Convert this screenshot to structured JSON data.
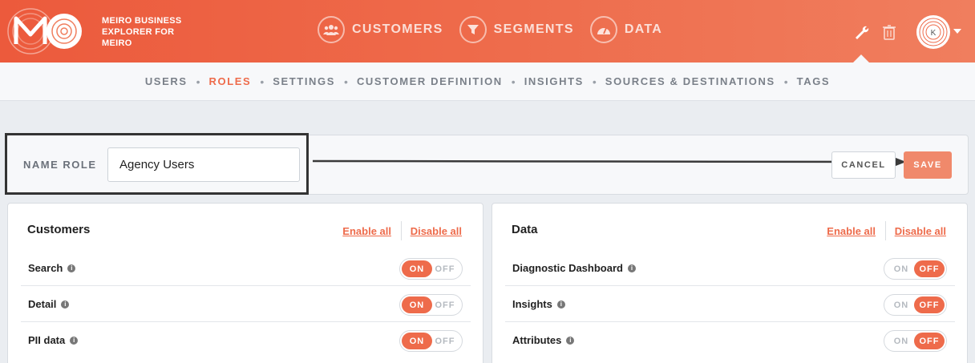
{
  "brand": {
    "logo_text": "MO",
    "line1": "MEIRO BUSINESS",
    "line2": "EXPLORER FOR",
    "line3": "MEIRO"
  },
  "nav": [
    {
      "label": "CUSTOMERS",
      "icon": "users-icon"
    },
    {
      "label": "SEGMENTS",
      "icon": "filter-icon"
    },
    {
      "label": "DATA",
      "icon": "gauge-icon"
    }
  ],
  "header_icons": {
    "settings": "wrench-icon",
    "trash": "trash-icon",
    "avatar_initial": "K"
  },
  "subnav": [
    "USERS",
    "ROLES",
    "SETTINGS",
    "CUSTOMER DEFINITION",
    "INSIGHTS",
    "SOURCES & DESTINATIONS",
    "TAGS"
  ],
  "subnav_active": "ROLES",
  "role_form": {
    "label": "NAME ROLE",
    "value": "Agency Users",
    "cancel": "CANCEL",
    "save": "SAVE"
  },
  "panels": {
    "customers": {
      "title": "Customers",
      "enable_all": "Enable all",
      "disable_all": "Disable all",
      "rows": [
        {
          "label": "Search",
          "on": true
        },
        {
          "label": "Detail",
          "on": true
        },
        {
          "label": "PII data",
          "on": true
        }
      ]
    },
    "data": {
      "title": "Data",
      "enable_all": "Enable all",
      "disable_all": "Disable all",
      "rows": [
        {
          "label": "Diagnostic Dashboard",
          "on": false
        },
        {
          "label": "Insights",
          "on": false
        },
        {
          "label": "Attributes",
          "on": false
        }
      ]
    }
  },
  "toggle": {
    "on_label": "ON",
    "off_label": "OFF"
  },
  "colors": {
    "accent": "#ee6b4b",
    "header_start": "#ec5a3c",
    "header_end": "#f07e5e",
    "save_bg": "#f0896b"
  }
}
